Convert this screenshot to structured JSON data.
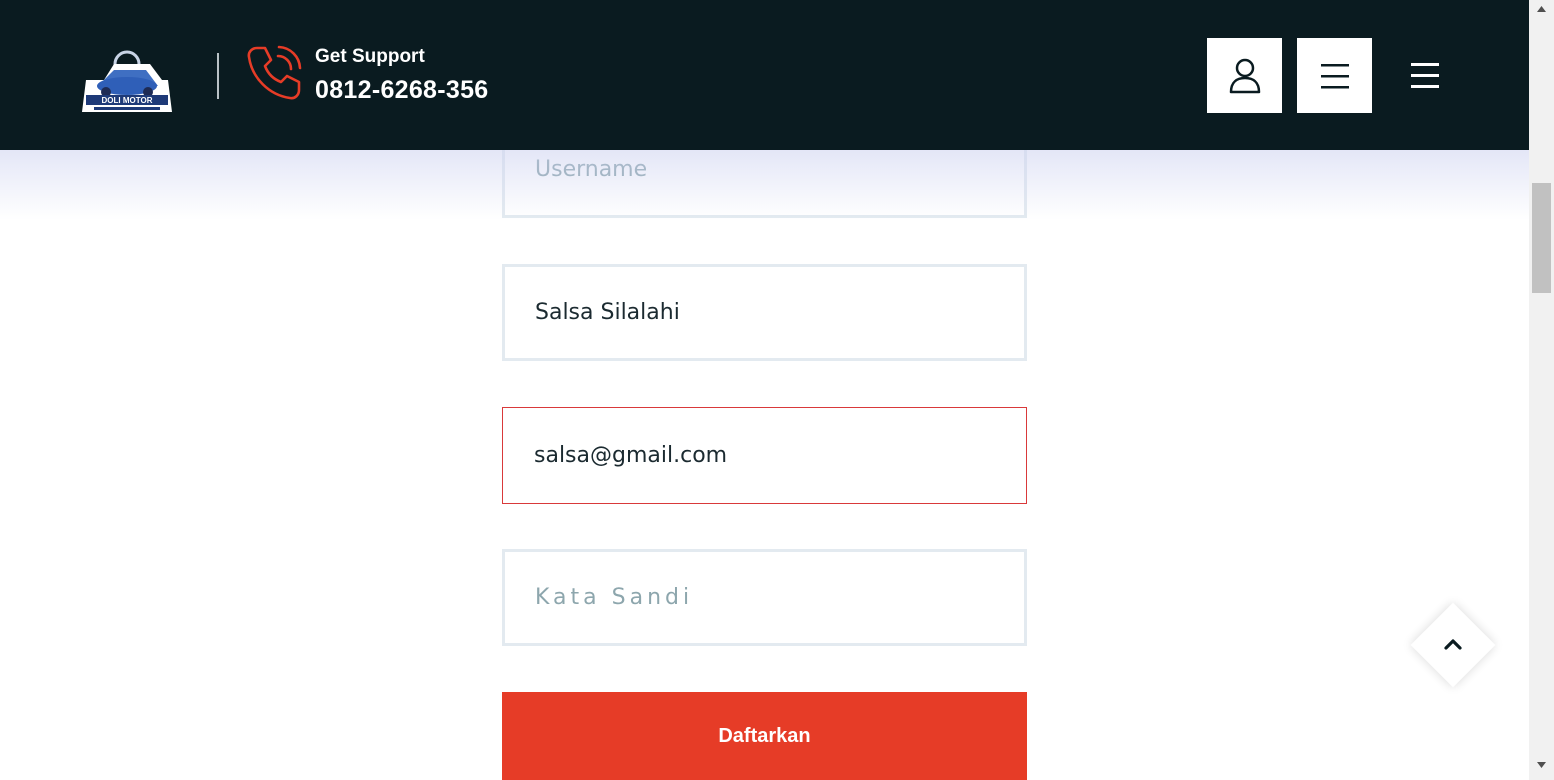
{
  "header": {
    "logo_text": "DOLI MOTOR",
    "support_label": "Get Support",
    "support_phone": "0812-6268-356",
    "colors": {
      "background": "#0a1b20",
      "accent": "#e63c27"
    }
  },
  "icons": {
    "user": "user-icon",
    "menu": "menu-icon",
    "hamburger": "hamburger-icon",
    "phone": "phone-icon",
    "back_to_top": "chevron-up-icon"
  },
  "form": {
    "username": {
      "placeholder": "Username",
      "value": ""
    },
    "name": {
      "placeholder": "",
      "value": "Salsa Silalahi"
    },
    "email": {
      "placeholder": "",
      "value": "salsa@gmail.com"
    },
    "password": {
      "placeholder": "Kata Sandi",
      "value": ""
    },
    "submit_label": "Daftarkan"
  }
}
